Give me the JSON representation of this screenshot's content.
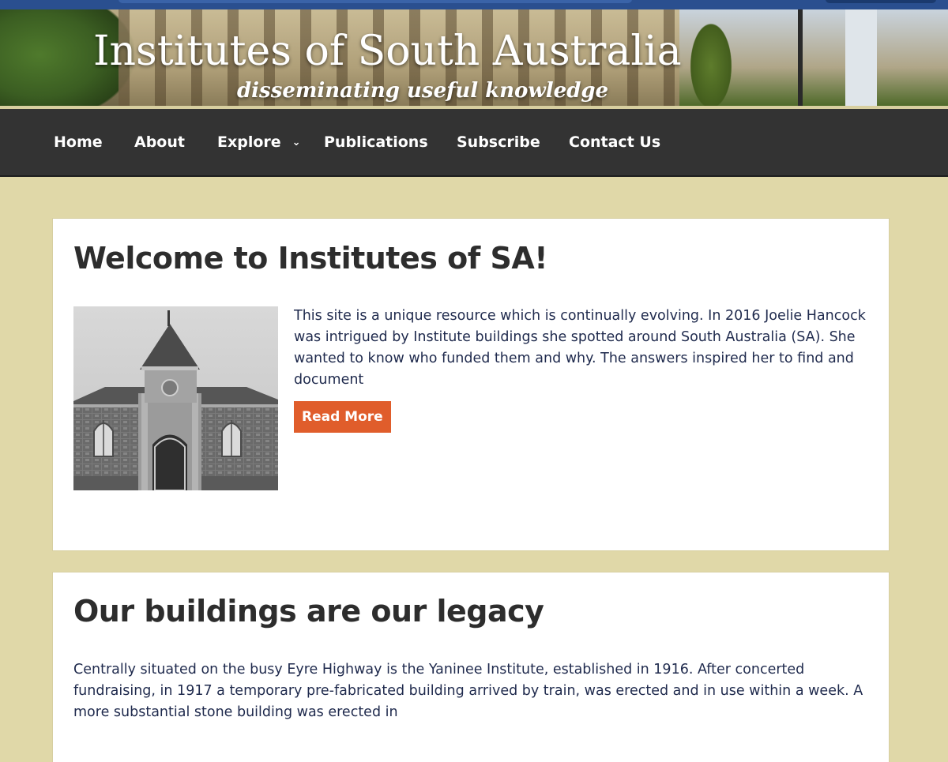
{
  "header": {
    "title": "Institutes of South Australia",
    "tagline": "disseminating useful knowledge"
  },
  "nav": {
    "items": [
      {
        "label": "Home"
      },
      {
        "label": "About"
      },
      {
        "label": "Explore",
        "has_submenu": true
      },
      {
        "label": "Publications"
      },
      {
        "label": "Subscribe"
      },
      {
        "label": "Contact Us"
      }
    ],
    "submenu_icon": "chevron-down-icon"
  },
  "posts": [
    {
      "title": "Welcome to Institutes of SA!",
      "excerpt": "This site is a unique resource which is continually evolving. In 2016 Joelie Hancock was intrigued by Institute buildings she spotted around South Australia (SA). She wanted to know who funded them and why. The answers inspired her to find and document",
      "button_label": "Read More",
      "image": "institute-building-photo"
    },
    {
      "title": "Our buildings are our legacy",
      "excerpt": "Centrally situated on the busy Eyre Highway is the Yaninee Institute, established in 1916. After concerted fundraising, in 1917 a temporary pre-fabricated building arrived by train, was erected and in use within a week. A more substantial stone building was erected in"
    }
  ],
  "colors": {
    "page_background": "#e0d8a8",
    "navbar": "#333333",
    "button": "#e05d2b",
    "body_text": "#1f2a4d",
    "heading": "#2d2d2d"
  }
}
